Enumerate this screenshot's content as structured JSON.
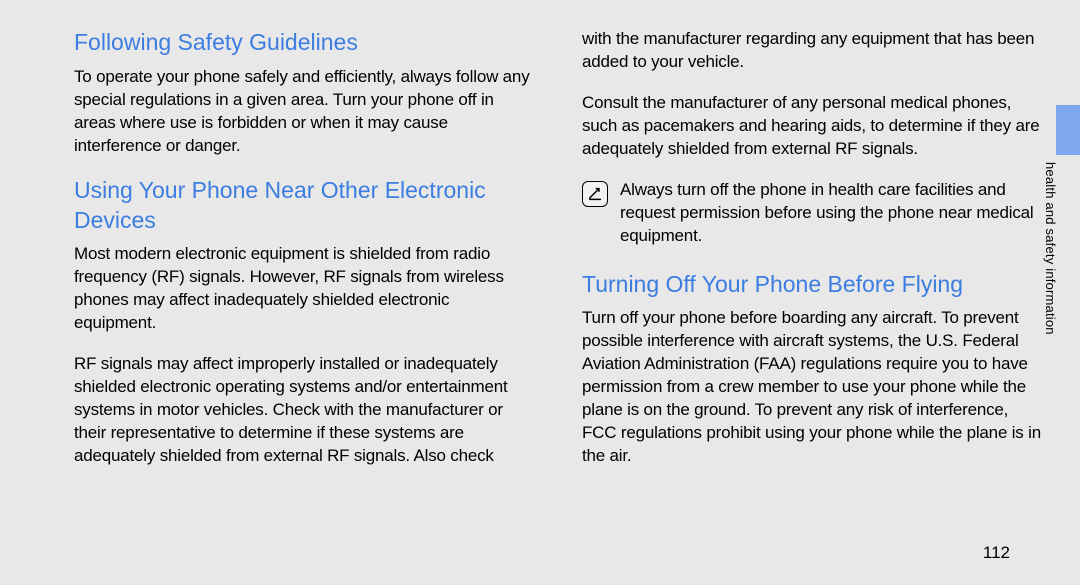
{
  "leftColumn": {
    "heading1": "Following Safety Guidelines",
    "para1": "To operate your phone safely and efficiently, always follow any special regulations in a given area. Turn your phone off in areas where use is forbidden or when it may cause interference or danger.",
    "heading2": "Using Your Phone Near Other Electronic Devices",
    "para2": "Most modern electronic equipment is shielded from radio frequency (RF) signals. However, RF signals from wireless phones may affect inadequately shielded electronic equipment.",
    "para3": "RF signals may affect improperly installed or inadequately shielded electronic operating systems and/or entertainment systems in motor vehicles. Check with the manufacturer or their representative to determine if these systems are adequately shielded from external RF signals. Also check"
  },
  "rightColumn": {
    "paraCont": "with the manufacturer regarding any equipment that has been added to your vehicle.",
    "para4": "Consult the manufacturer of any personal medical phones, such as pacemakers and hearing aids, to determine if they are adequately shielded from external RF signals.",
    "noteText": "Always turn off the phone in health care facilities and request permission before using the phone near medical equipment.",
    "heading3": "Turning Off Your Phone Before Flying",
    "para5": "Turn off your phone before boarding any aircraft. To prevent possible interference with aircraft systems, the U.S. Federal Aviation Administration (FAA) regulations require you to have permission from a crew member to use your phone while the plane is on the ground. To prevent any risk of interference, FCC regulations prohibit using your phone while the plane is in the air."
  },
  "sideLabel": "health and safety information",
  "pageNumber": "112"
}
